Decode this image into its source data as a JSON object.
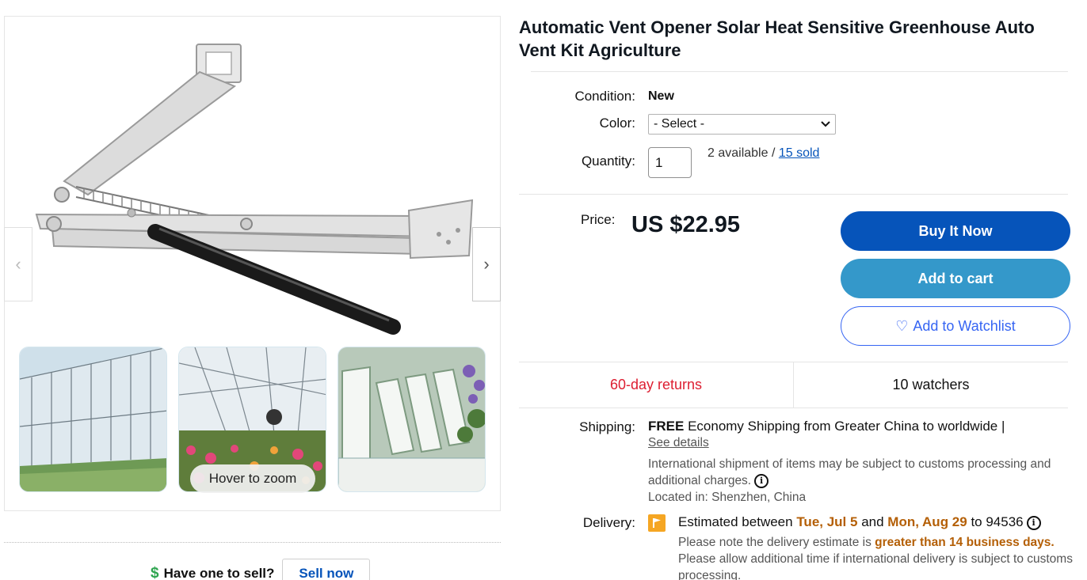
{
  "listing": {
    "title": "Automatic Vent Opener Solar Heat Sensitive Greenhouse Auto Vent Kit Agriculture"
  },
  "gallery": {
    "prev_arrow": "‹",
    "next_arrow": "›",
    "zoom_hint": "Hover to zoom"
  },
  "sell": {
    "icon": "$",
    "prompt": "Have one to sell?",
    "button": "Sell now"
  },
  "condition": {
    "label": "Condition:",
    "value": "New"
  },
  "color": {
    "label": "Color:",
    "selected": "- Select -"
  },
  "quantity": {
    "label": "Quantity:",
    "value": "1",
    "available": "2 available",
    "separator": " / ",
    "sold": "15 sold"
  },
  "price": {
    "label": "Price:",
    "value": "US $22.95"
  },
  "buttons": {
    "buy": "Buy It Now",
    "cart": "Add to cart",
    "watch_icon": "♡",
    "watch": "Add to Watchlist"
  },
  "stats": {
    "returns": "60-day returns",
    "watchers": "10 watchers"
  },
  "shipping": {
    "label": "Shipping:",
    "free": "FREE",
    "description": " Economy Shipping from Greater China to worldwide |",
    "see_details": "See details",
    "note": "International shipment of items may be subject to customs processing and additional charges.",
    "located": "Located in: Shenzhen, China"
  },
  "delivery": {
    "label": "Delivery:",
    "prefix": "Estimated between ",
    "start": "Tue, Jul 5",
    "and": " and ",
    "end": "Mon, Aug 29",
    "to": " to 94536",
    "note_prefix": "Please note the delivery estimate is ",
    "note_highlight": "greater than 14 business days.",
    "note2": "Please allow additional time if international delivery is subject to customs processing."
  },
  "colors": {
    "primary_blue": "#0654ba",
    "cart_blue": "#3498ca",
    "watch_blue": "#3665f3",
    "returns_red": "#dd1e31",
    "delivery_orange": "#b45f06"
  }
}
